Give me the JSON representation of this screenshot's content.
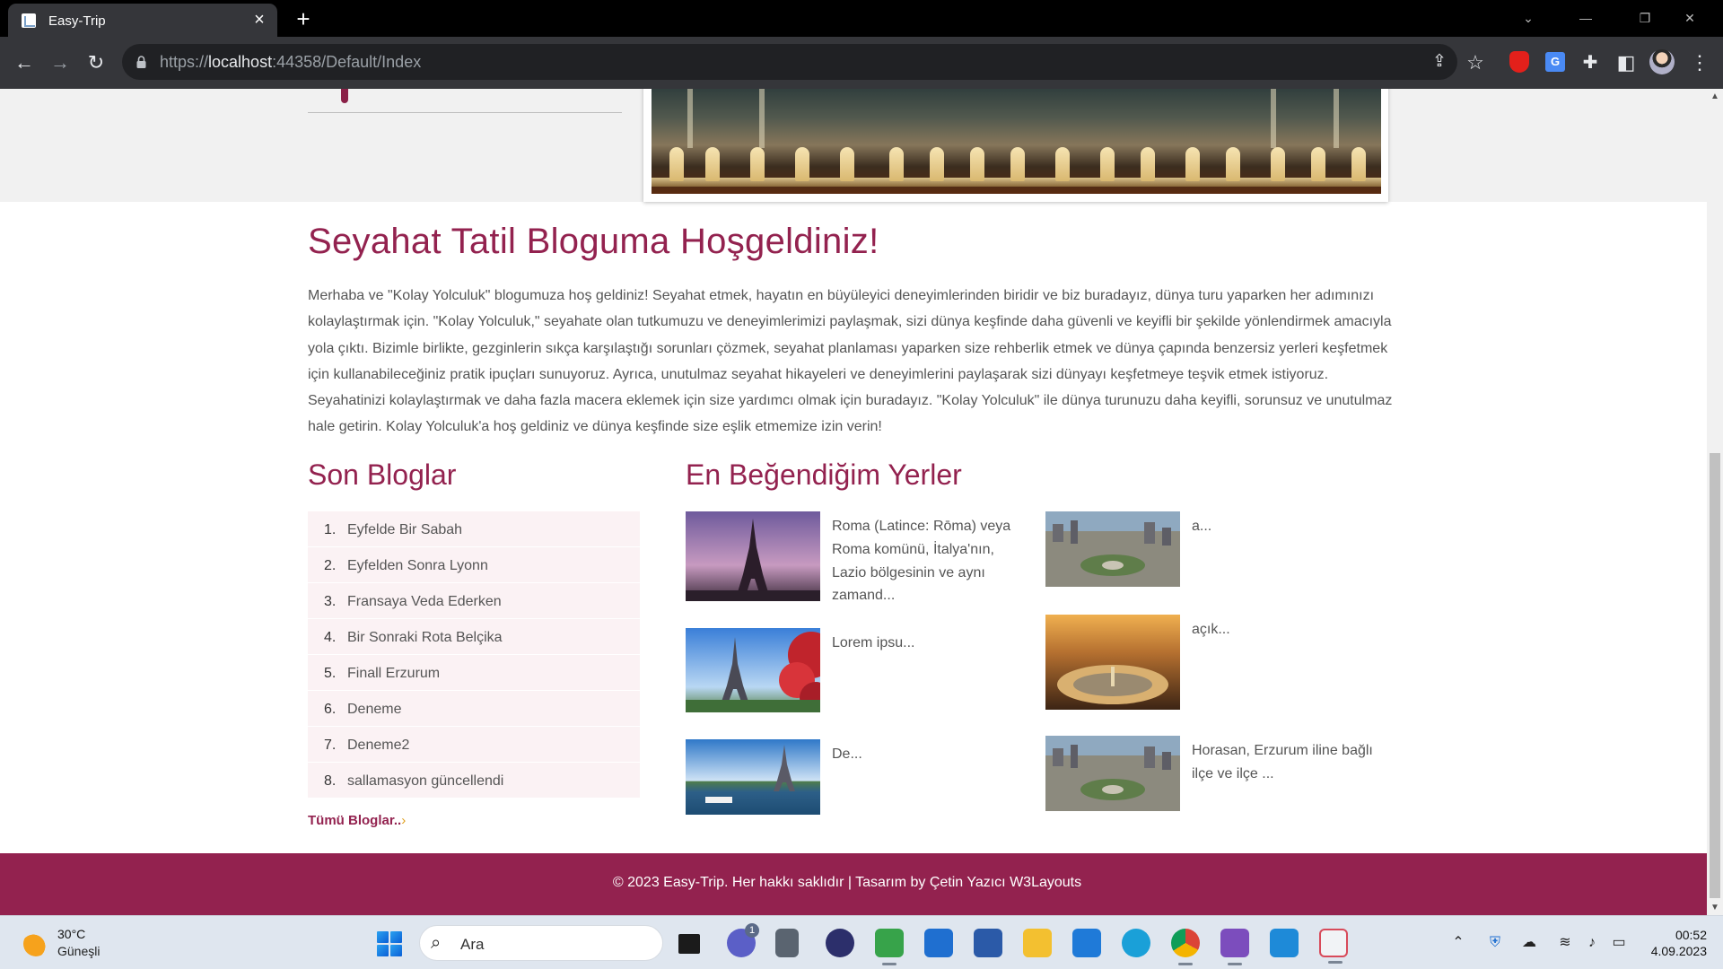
{
  "browser": {
    "tab_title": "Easy-Trip",
    "url_scheme": "https://",
    "url_host": "localhost",
    "url_rest": ":44358/Default/Index"
  },
  "page": {
    "welcome_title": "Seyahat Tatil Bloguma Hoşgeldiniz!",
    "intro": "Merhaba ve \"Kolay Yolculuk\" blogumuza hoş geldiniz! Seyahat etmek, hayatın en büyüleyici deneyimlerinden biridir ve biz buradayız, dünya turu yaparken her adımınızı kolaylaştırmak için. \"Kolay Yolculuk,\" seyahate olan tutkumuzu ve deneyimlerimizi paylaşmak, sizi dünya keşfinde daha güvenli ve keyifli bir şekilde yönlendirmek amacıyla yola çıktı. Bizimle birlikte, gezginlerin sıkça karşılaştığı sorunları çözmek, seyahat planlaması yaparken size rehberlik etmek ve dünya çapında benzersiz yerleri keşfetmek için kullanabileceğiniz pratik ipuçları sunuyoruz. Ayrıca, unutulmaz seyahat hikayeleri ve deneyimlerini paylaşarak sizi dünyayı keşfetmeye teşvik etmek istiyoruz. Seyahatinizi kolaylaştırmak ve daha fazla macera eklemek için size yardımcı olmak için buradayız. \"Kolay Yolculuk\" ile dünya turunuzu daha keyifli, sorunsuz ve unutulmaz hale getirin. Kolay Yolculuk'a hoş geldiniz ve dünya keşfinde size eşlik etmemize izin verin!",
    "recent_title": "Son Bloglar",
    "recent_blogs": [
      {
        "num": "1.",
        "title": "Eyfelde Bir Sabah"
      },
      {
        "num": "2.",
        "title": "Eyfelden Sonra Lyonn"
      },
      {
        "num": "3.",
        "title": "Fransaya Veda Ederken"
      },
      {
        "num": "4.",
        "title": "Bir Sonraki Rota Belçika"
      },
      {
        "num": "5.",
        "title": "Finall Erzurum"
      },
      {
        "num": "6.",
        "title": "Deneme"
      },
      {
        "num": "7.",
        "title": "Deneme2"
      },
      {
        "num": "8.",
        "title": "sallamasyon güncellendi"
      }
    ],
    "all_blogs_link": "Tümü Bloglar..",
    "all_blogs_chevron": "›",
    "favorites_title": "En Beğendiğim Yerler",
    "favorites": [
      {
        "desc": "Roma (Latince: Rōma) veya Roma komünü, İtalya'nın, Lazio bölgesinin ve aynı zamand...",
        "image": "eiffel-purple-sky"
      },
      {
        "desc": "a...",
        "image": "city-aerial"
      },
      {
        "desc": "Lorem ipsu...",
        "image": "eiffel-red-leaves"
      },
      {
        "desc": "açık...",
        "image": "st-peters-square"
      },
      {
        "desc": "De...",
        "image": "eiffel-seine-boat"
      },
      {
        "desc": "Horasan, Erzurum iline bağlı ilçe ve ilçe ...",
        "image": "city-aerial"
      }
    ],
    "footer": "© 2023 Easy-Trip. Her hakkı saklıdır | Tasarım by Çetin Yazıcı W3Layouts"
  },
  "taskbar": {
    "temperature": "30°C",
    "condition": "Güneşli",
    "search_label": "Ara",
    "teams_badge": "1",
    "time": "00:52",
    "date": "4.09.2023"
  },
  "colors": {
    "accent": "#93224f",
    "list_bg": "#fbf2f4",
    "chrome_dark": "#35363a"
  }
}
